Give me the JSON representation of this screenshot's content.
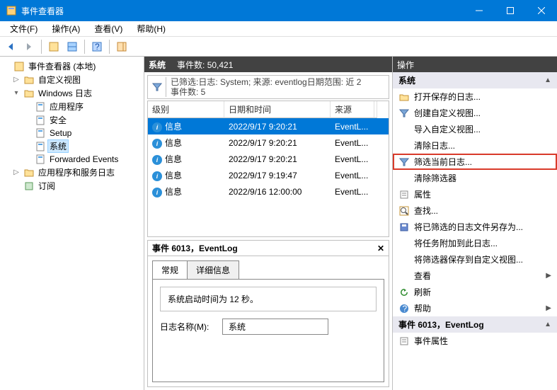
{
  "window": {
    "title": "事件查看器"
  },
  "menus": {
    "file": "文件(F)",
    "action": "操作(A)",
    "view": "查看(V)",
    "help": "帮助(H)"
  },
  "tree": {
    "root": "事件查看器 (本地)",
    "custom": "自定义视图",
    "winlogs": "Windows 日志",
    "app": "应用程序",
    "security": "安全",
    "setup": "Setup",
    "system": "系统",
    "forwarded": "Forwarded Events",
    "appsvc": "应用程序和服务日志",
    "subs": "订阅"
  },
  "center": {
    "title": "系统",
    "count_label": "事件数:",
    "count_value": "50,421",
    "filter_line1": "已筛选:日志: System; 来源: eventlog日期范围: 近 2",
    "filter_line2": "事件数: 5",
    "cols": {
      "level": "级别",
      "datetime": "日期和时间",
      "source": "来源"
    },
    "rows": [
      {
        "level": "信息",
        "datetime": "2022/9/17 9:20:21",
        "source": "EventL..."
      },
      {
        "level": "信息",
        "datetime": "2022/9/17 9:20:21",
        "source": "EventL..."
      },
      {
        "level": "信息",
        "datetime": "2022/9/17 9:20:21",
        "source": "EventL..."
      },
      {
        "level": "信息",
        "datetime": "2022/9/17 9:19:47",
        "source": "EventL..."
      },
      {
        "level": "信息",
        "datetime": "2022/9/16 12:00:00",
        "source": "EventL..."
      }
    ]
  },
  "detail": {
    "title": "事件 6013，EventLog",
    "tabs": {
      "general": "常规",
      "details": "详细信息"
    },
    "body_text": "系统启动时间为 12 秒。",
    "log_name_label": "日志名称(M):",
    "log_name_value": "系统"
  },
  "actions": {
    "header": "操作",
    "section1": "系统",
    "items1": [
      {
        "label": "打开保存的日志...",
        "icon": "folder-open-icon"
      },
      {
        "label": "创建自定义视图...",
        "icon": "funnel-icon"
      },
      {
        "label": "导入自定义视图...",
        "icon": "blank-icon"
      },
      {
        "label": "清除日志...",
        "icon": "blank-icon"
      },
      {
        "label": "筛选当前日志...",
        "icon": "funnel-icon",
        "highlight": true
      },
      {
        "label": "清除筛选器",
        "icon": "blank-icon"
      },
      {
        "label": "属性",
        "icon": "properties-icon"
      },
      {
        "label": "查找...",
        "icon": "find-icon"
      },
      {
        "label": "将已筛选的日志文件另存为...",
        "icon": "save-icon"
      },
      {
        "label": "将任务附加到此日志...",
        "icon": "blank-icon"
      },
      {
        "label": "将筛选器保存到自定义视图...",
        "icon": "blank-icon"
      },
      {
        "label": "查看",
        "icon": "blank-icon",
        "submenu": true
      },
      {
        "label": "刷新",
        "icon": "refresh-icon"
      },
      {
        "label": "帮助",
        "icon": "help-icon",
        "submenu": true
      }
    ],
    "section2": "事件 6013，EventLog",
    "items2": [
      {
        "label": "事件属性",
        "icon": "properties-icon"
      }
    ]
  }
}
